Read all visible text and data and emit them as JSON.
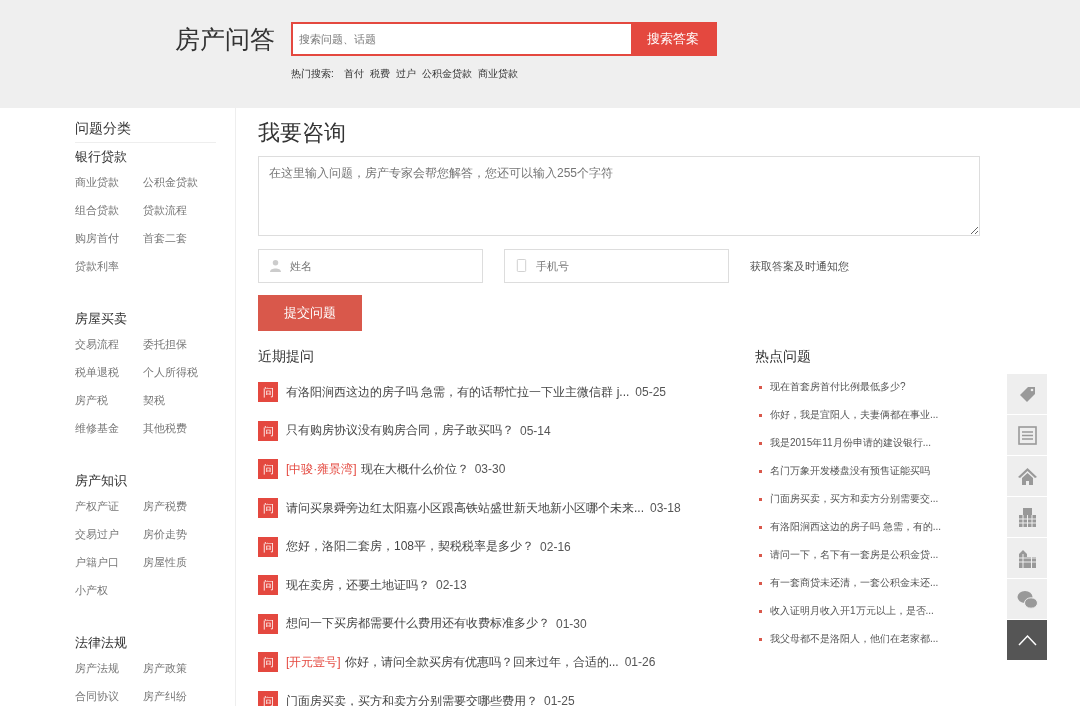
{
  "header": {
    "title": "房产问答",
    "search": {
      "placeholder": "搜索问题、话题",
      "button": "搜索答案"
    },
    "hot_label": "热门搜索:",
    "hot_terms": [
      "首付",
      "税费",
      "过户",
      "公积金贷款",
      "商业贷款"
    ]
  },
  "sidebar": {
    "title": "问题分类",
    "groups": [
      {
        "name": "银行贷款",
        "items": [
          "商业贷款",
          "公积金贷款",
          "组合贷款",
          "贷款流程",
          "购房首付",
          "首套二套",
          "贷款利率"
        ]
      },
      {
        "name": "房屋买卖",
        "items": [
          "交易流程",
          "委托担保",
          "税单退税",
          "个人所得税",
          "房产税",
          "契税",
          "维修基金",
          "其他税费"
        ]
      },
      {
        "name": "房产知识",
        "items": [
          "产权产证",
          "房产税费",
          "交易过户",
          "房价走势",
          "户籍户口",
          "房屋性质",
          "小产权"
        ]
      },
      {
        "name": "法律法规",
        "items": [
          "房产法规",
          "房产政策",
          "合同协议",
          "房产纠纷"
        ]
      }
    ]
  },
  "ask": {
    "title": "我要咨询",
    "question_placeholder": "在这里输入问题，房产专家会帮您解答，您还可以输入255个字符",
    "name_placeholder": "姓名",
    "phone_placeholder": "手机号",
    "notice": "获取答案及时通知您",
    "submit": "提交问题"
  },
  "recent": {
    "title": "近期提问",
    "items": [
      {
        "badge": "问",
        "text": "有洛阳涧西这边的房子吗 急需，有的话帮忙拉一下业主微信群 j...",
        "date": "05-25"
      },
      {
        "badge": "问",
        "text": "只有购房协议没有购房合同，房子敢买吗？",
        "date": "05-14"
      },
      {
        "badge": "问",
        "tag": "[中骏·雍景湾]",
        "text": "现在大概什么价位？",
        "date": "03-30"
      },
      {
        "badge": "问",
        "text": "请问买泉舜旁边红太阳嘉小区跟高铁站盛世新天地新小区哪个未来...",
        "date": "03-18"
      },
      {
        "badge": "问",
        "text": "您好，洛阳二套房，108平，契税税率是多少？",
        "date": "02-16"
      },
      {
        "badge": "问",
        "text": "现在卖房，还要土地证吗？",
        "date": "02-13"
      },
      {
        "badge": "问",
        "text": "想问一下买房都需要什么费用还有收费标准多少？",
        "date": "01-30"
      },
      {
        "badge": "问",
        "tag": "[开元壹号]",
        "text": "你好，请问全款买房有优惠吗？回来过年，合适的...",
        "date": "01-26"
      },
      {
        "badge": "问",
        "text": "门面房买卖，买方和卖方分别需要交哪些费用？",
        "date": "01-25"
      }
    ]
  },
  "hot": {
    "title": "热点问题",
    "items": [
      "现在首套房首付比例最低多少?",
      "你好，我是宜阳人，夫妻俩都在事业...",
      "我是2015年11月份申请的建设银行...",
      "名门万象开发楼盘没有预售证能买吗",
      "门面房买卖，买方和卖方分别需要交...",
      "有洛阳涧西这边的房子吗 急需，有的...",
      "请问一下，名下有一套房是公积金贷...",
      "有一套商贷未还清，一套公积金未还...",
      "收入证明月收入开1万元以上，是否...",
      "我父母都不是洛阳人，他们在老家都..."
    ]
  },
  "float_bar": [
    {
      "kind": "tag"
    },
    {
      "kind": "list"
    },
    {
      "kind": "house"
    },
    {
      "kind": "office"
    },
    {
      "kind": "city"
    },
    {
      "kind": "chat"
    },
    {
      "kind": "top"
    }
  ]
}
